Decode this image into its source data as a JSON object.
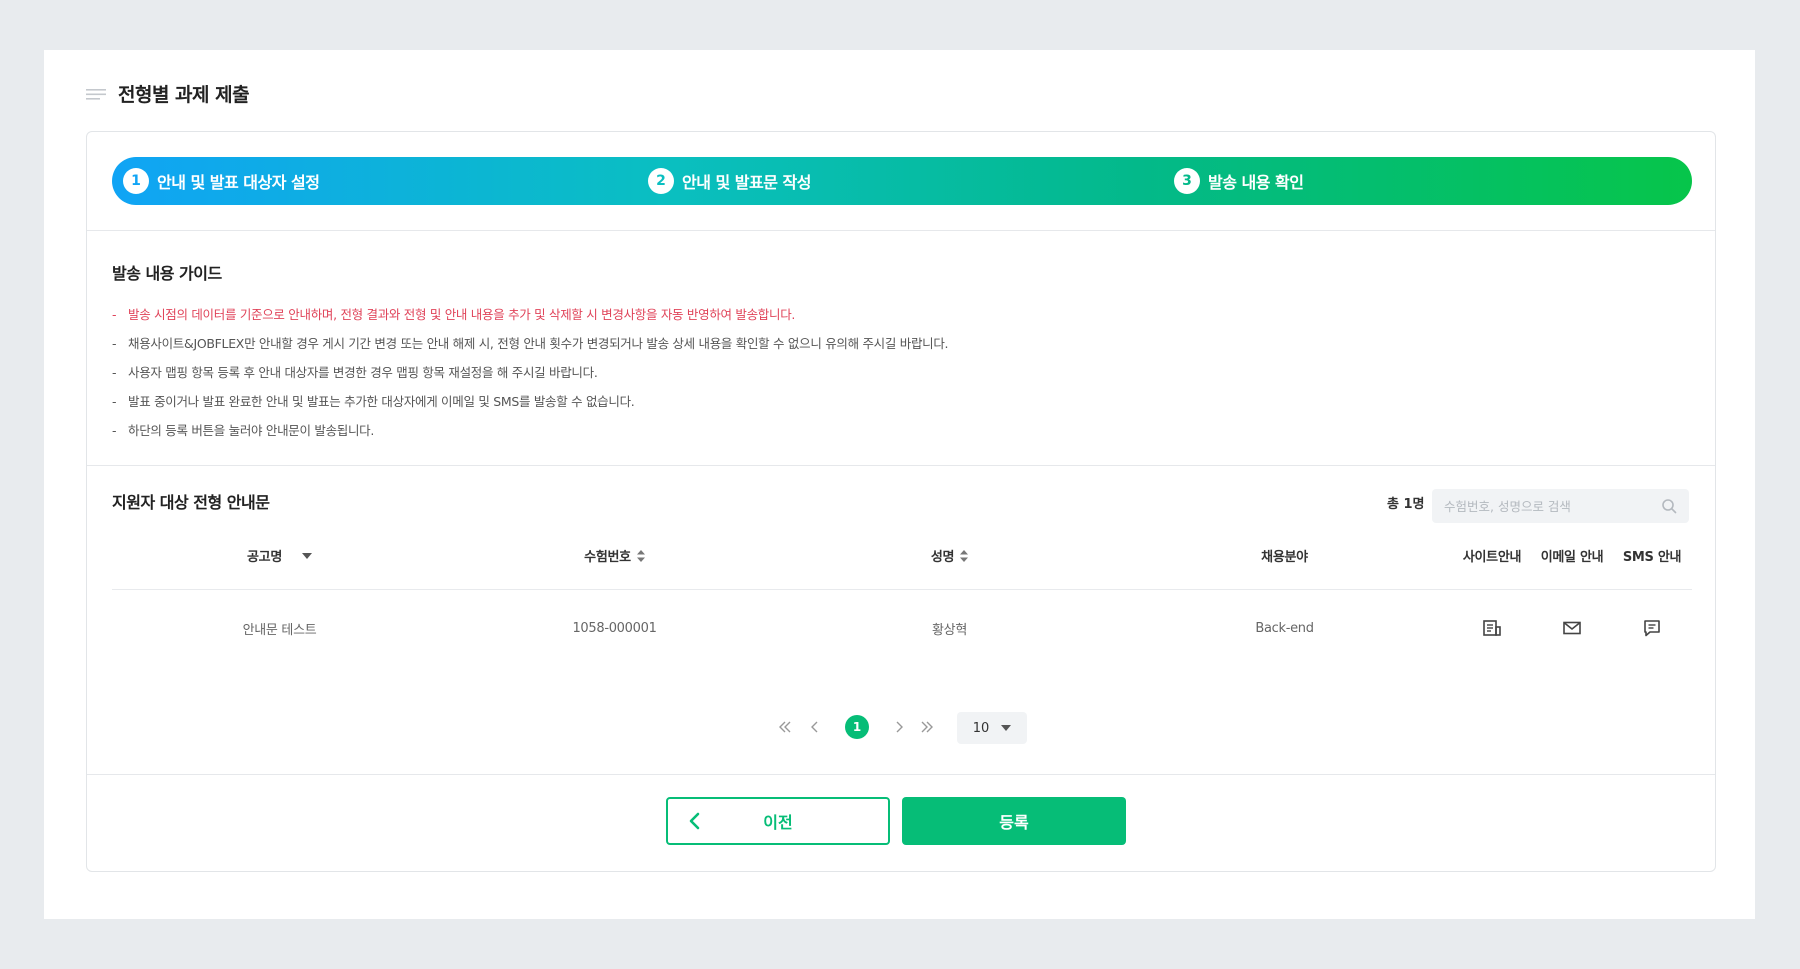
{
  "page": {
    "title": "전형별 과제 제출"
  },
  "stepper": {
    "steps": [
      {
        "number": "1",
        "label": "안내 및 발표 대상자 설정",
        "color": "#10a4f5"
      },
      {
        "number": "2",
        "label": "안내 및 발표문 작성",
        "color": "#0abfc1"
      },
      {
        "number": "3",
        "label": "발송 내용 확인",
        "color": "#03b98a"
      }
    ]
  },
  "guide": {
    "title": "발송 내용 가이드",
    "items": [
      "발송 시점의 데이터를 기준으로 안내하며, 전형 결과와 전형 및 안내 내용을 추가 및 삭제할 시 변경사항을 자동 반영하여 발송합니다.",
      "채용사이트&JOBFLEX만 안내할 경우 게시 기간 변경 또는 안내 해제 시, 전형 안내 횟수가 변경되거나 발송 상세 내용을 확인할 수 없으니 유의해 주시길 바랍니다.",
      "사용자 맵핑 항목 등록 후 안내 대상자를 변경한 경우 맵핑 항목 재설정을 해 주시길 바랍니다.",
      "발표 중이거나 발표 완료한 안내 및 발표는 추가한 대상자에게 이메일 및 SMS를 발송할 수 없습니다.",
      "하단의 등록 버튼을 눌러야 안내문이 발송됩니다."
    ],
    "dash": "-",
    "warn_color": "#e0445a"
  },
  "applicants": {
    "title": "지원자 대상 전형 안내문",
    "total": "총 1명",
    "search_placeholder": "수험번호, 성명으로 검색",
    "columns": {
      "posting": "공고명",
      "exam_no": "수험번호",
      "name": "성명",
      "field": "채용분야",
      "site": "사이트안내",
      "email": "이메일 안내",
      "sms": "SMS 안내"
    },
    "rows": [
      {
        "posting": "안내문 테스트",
        "exam_no": "1058-000001",
        "name": "황상혁",
        "field": "Back-end"
      }
    ]
  },
  "pagination": {
    "current": "1",
    "page_size": "10"
  },
  "actions": {
    "prev_label": "이전",
    "submit_label": "등록"
  },
  "colors": {
    "accent": "#06bd77",
    "warn": "#e0445a"
  }
}
